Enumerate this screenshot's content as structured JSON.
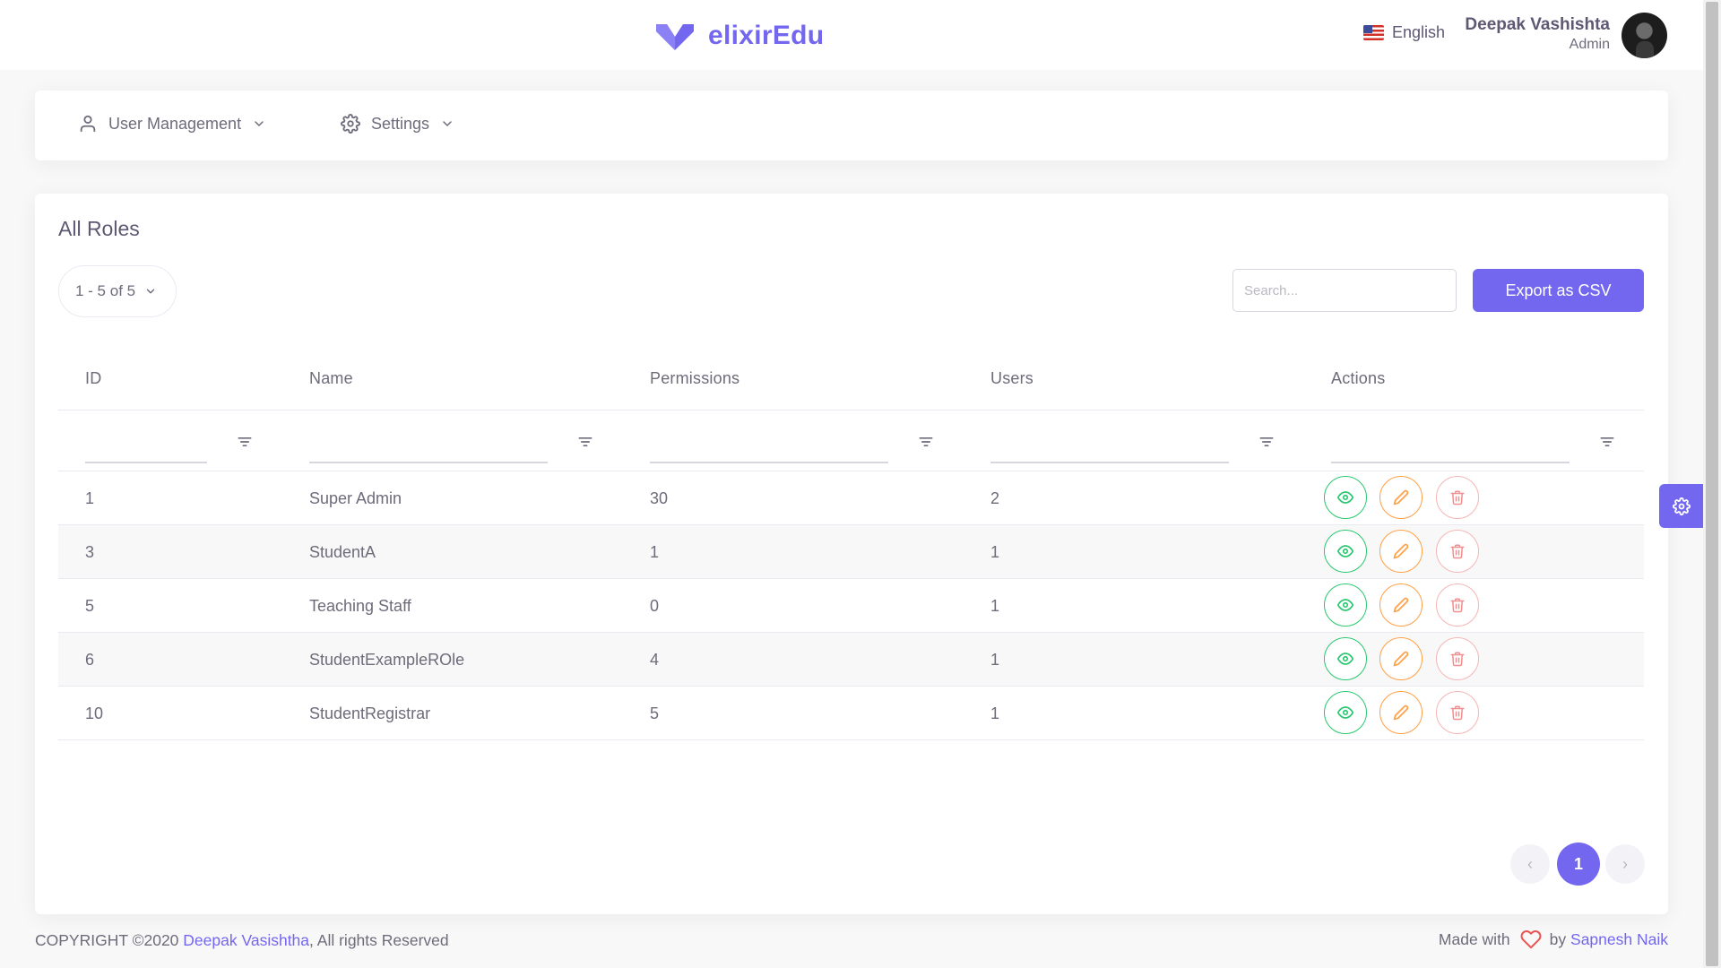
{
  "brand": {
    "name": "elixirEdu"
  },
  "language": {
    "label": "English"
  },
  "user": {
    "name": "Deepak Vashishta",
    "role": "Admin"
  },
  "menu": {
    "items": [
      {
        "label": "User Management"
      },
      {
        "label": "Settings"
      }
    ]
  },
  "card": {
    "title": "All Roles",
    "per_page": "1 - 5 of 5",
    "search_placeholder": "Search...",
    "export_label": "Export as CSV"
  },
  "table": {
    "columns": [
      "ID",
      "Name",
      "Permissions",
      "Users",
      "Actions"
    ],
    "rows": [
      {
        "id": "1",
        "name": "Super Admin",
        "permissions": "30",
        "users": "2"
      },
      {
        "id": "3",
        "name": "StudentA",
        "permissions": "1",
        "users": "1"
      },
      {
        "id": "5",
        "name": "Teaching Staff",
        "permissions": "0",
        "users": "1"
      },
      {
        "id": "6",
        "name": "StudentExampleROle",
        "permissions": "4",
        "users": "1"
      },
      {
        "id": "10",
        "name": "StudentRegistrar",
        "permissions": "5",
        "users": "1"
      }
    ]
  },
  "pagination": {
    "prev": "‹",
    "current": "1",
    "next": "›"
  },
  "footer": {
    "copyright_prefix": "COPYRIGHT ©2020 ",
    "author": "Deepak Vasishtha",
    "copyright_suffix": ", All rights Reserved",
    "made_with": "Made with",
    "by": "by ",
    "maker": "Sapnesh Naik"
  },
  "colors": {
    "primary": "#7367f0",
    "success": "#28c76f",
    "warning": "#ff9f43",
    "danger": "#ea5455"
  },
  "icons": [
    "logo-icon",
    "user-icon",
    "chevron-down-icon",
    "gear-icon",
    "filter-icon",
    "eye-icon",
    "pencil-icon",
    "trash-icon",
    "heart-icon"
  ]
}
